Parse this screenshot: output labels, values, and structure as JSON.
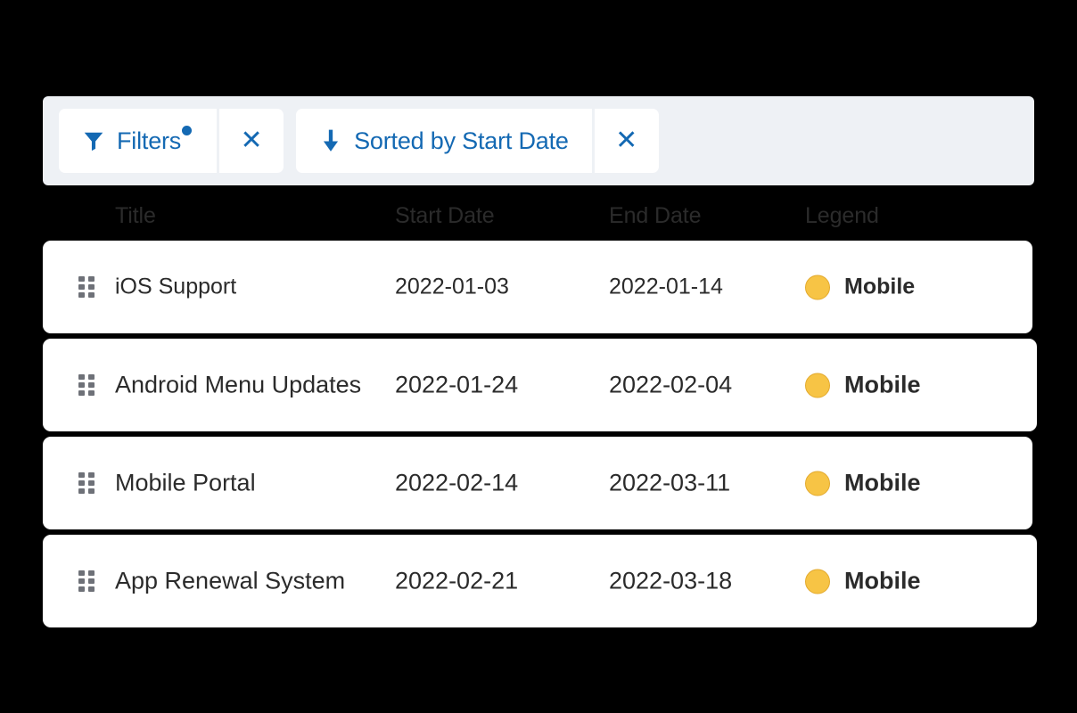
{
  "toolbar": {
    "background_color": "#eef1f5",
    "accent_color": "#1469b3",
    "chips": [
      {
        "icon": "funnel-icon",
        "label": "Filters",
        "has_badge": true,
        "clear_label": "✕"
      },
      {
        "icon": "arrow-down-icon",
        "label": "Sorted by Start Date",
        "has_badge": false,
        "clear_label": "✕"
      }
    ]
  },
  "table": {
    "columns": [
      "Title",
      "Start Date",
      "End Date",
      "Legend"
    ],
    "rows": [
      {
        "title": "iOS Support",
        "start_date": "2022-01-03",
        "end_date": "2022-01-14",
        "legend_label": "Mobile",
        "legend_color": "#f7c445"
      },
      {
        "title": "Android Menu Updates",
        "start_date": "2022-01-24",
        "end_date": "2022-02-04",
        "legend_label": "Mobile",
        "legend_color": "#f7c445"
      },
      {
        "title": "Mobile Portal",
        "start_date": "2022-02-14",
        "end_date": "2022-03-11",
        "legend_label": "Mobile",
        "legend_color": "#f7c445"
      },
      {
        "title": "App Renewal System",
        "start_date": "2022-02-21",
        "end_date": "2022-03-18",
        "legend_label": "Mobile",
        "legend_color": "#f7c445"
      }
    ]
  }
}
